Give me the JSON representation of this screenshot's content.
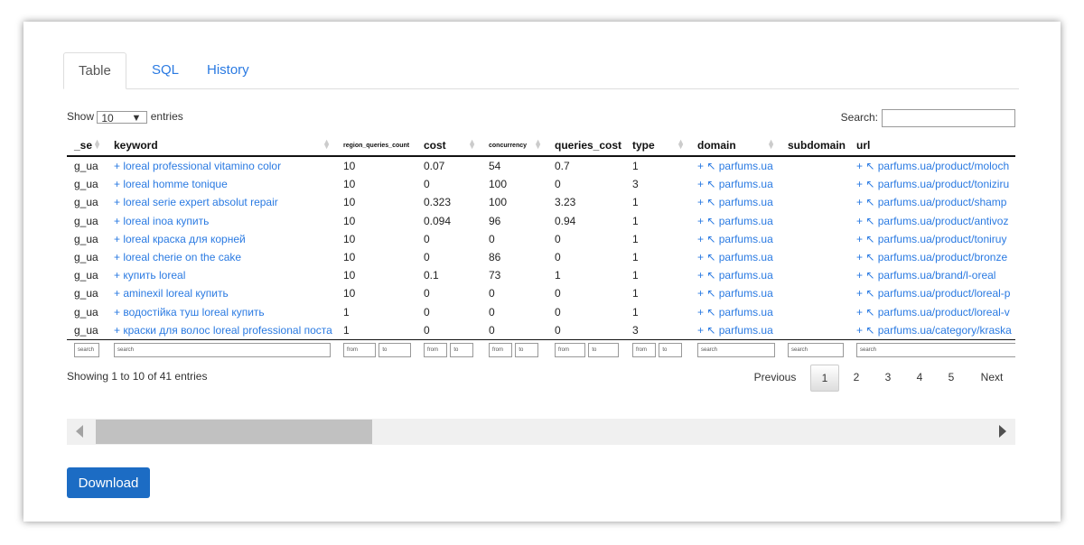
{
  "tabs": [
    {
      "label": "Table",
      "active": true
    },
    {
      "label": "SQL",
      "active": false
    },
    {
      "label": "History",
      "active": false
    }
  ],
  "length_control": {
    "prefix": "Show",
    "selected": "10",
    "suffix": "entries"
  },
  "search": {
    "label": "Search:",
    "value": ""
  },
  "table": {
    "columns": [
      "_se",
      "keyword",
      "region_queries_count",
      "cost",
      "concurrency",
      "queries_cost",
      "type",
      "domain",
      "subdomain",
      "url"
    ],
    "rows": [
      [
        "g_ua",
        "+ loreal professional vitamino color",
        "10",
        "0.07",
        "54",
        "0.7",
        "1",
        "+ ↖ parfums.ua",
        "",
        "+ ↖ parfums.ua/product/moloch"
      ],
      [
        "g_ua",
        "+ loreal homme tonique",
        "10",
        "0",
        "100",
        "0",
        "3",
        "+ ↖ parfums.ua",
        "",
        "+ ↖ parfums.ua/product/toniziru"
      ],
      [
        "g_ua",
        "+ loreal serie expert absolut repair",
        "10",
        "0.323",
        "100",
        "3.23",
        "1",
        "+ ↖ parfums.ua",
        "",
        "+ ↖ parfums.ua/product/shamp"
      ],
      [
        "g_ua",
        "+ loreal inoa купить",
        "10",
        "0.094",
        "96",
        "0.94",
        "1",
        "+ ↖ parfums.ua",
        "",
        "+ ↖ parfums.ua/product/antivoz"
      ],
      [
        "g_ua",
        "+ loreal краска для корней",
        "10",
        "0",
        "0",
        "0",
        "1",
        "+ ↖ parfums.ua",
        "",
        "+ ↖ parfums.ua/product/toniruy"
      ],
      [
        "g_ua",
        "+ loreal cherie on the cake",
        "10",
        "0",
        "86",
        "0",
        "1",
        "+ ↖ parfums.ua",
        "",
        "+ ↖ parfums.ua/product/bronze"
      ],
      [
        "g_ua",
        "+ купить loreal",
        "10",
        "0.1",
        "73",
        "1",
        "1",
        "+ ↖ parfums.ua",
        "",
        "+ ↖ parfums.ua/brand/l-oreal"
      ],
      [
        "g_ua",
        "+ aminexil loreal купить",
        "10",
        "0",
        "0",
        "0",
        "1",
        "+ ↖ parfums.ua",
        "",
        "+ ↖ parfums.ua/product/loreal-p"
      ],
      [
        "g_ua",
        "+ водостійка туш loreal купить",
        "1",
        "0",
        "0",
        "0",
        "1",
        "+ ↖ parfums.ua",
        "",
        "+ ↖ parfums.ua/product/loreal-v"
      ],
      [
        "g_ua",
        "+ краски для волос loreal professional поста",
        "1",
        "0",
        "0",
        "0",
        "3",
        "+ ↖ parfums.ua",
        "",
        "+ ↖ parfums.ua/category/kraska"
      ]
    ],
    "filters": {
      "search": "search",
      "from": "from",
      "to": "to"
    }
  },
  "info": "Showing 1 to 10 of 41 entries",
  "pagination": {
    "previous": "Previous",
    "pages": [
      "1",
      "2",
      "3",
      "4",
      "5"
    ],
    "current": "1",
    "next": "Next"
  },
  "download_label": "Download",
  "colors": {
    "link": "#2a7ae2",
    "primary_button": "#1c6cc4"
  }
}
